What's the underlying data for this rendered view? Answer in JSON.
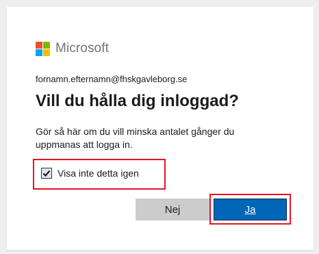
{
  "brand": {
    "name": "Microsoft",
    "colors": {
      "red": "#f25022",
      "green": "#7fba00",
      "blue": "#00a4ef",
      "yellow": "#ffb900"
    }
  },
  "account": {
    "email": "fornamn.efternamn@fhskgavleborg.se"
  },
  "dialog": {
    "title": "Vill du hålla dig inloggad?",
    "description": "Gör så här om du vill minska antalet gånger du uppmanas att logga in.",
    "checkbox": {
      "label": "Visa inte detta igen",
      "checked": true
    },
    "buttons": {
      "no_label": "Nej",
      "yes_label": "Ja"
    }
  },
  "annotation_color": "#e81123",
  "primary_color": "#0067b8"
}
